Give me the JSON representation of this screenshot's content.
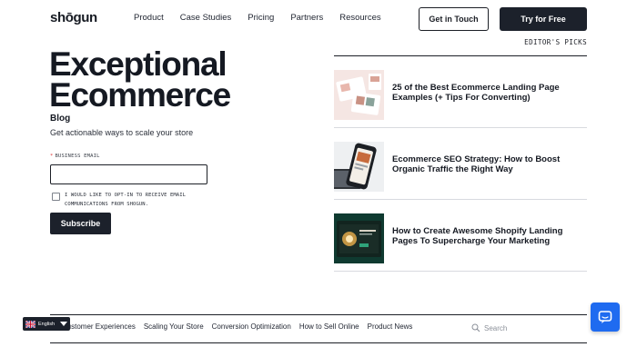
{
  "header": {
    "logo": "shōgun",
    "nav": [
      "Product",
      "Case Studies",
      "Pricing",
      "Partners",
      "Resources"
    ],
    "get_in_touch": "Get in Touch",
    "try_free": "Try for Free"
  },
  "hero": {
    "title_line1": "Exceptional",
    "title_line2": "Ecommerce",
    "subtitle": "Blog",
    "description": "Get actionable ways to scale your store"
  },
  "signup": {
    "required_mark": "*",
    "email_label": "BUSINESS EMAIL",
    "email_value": "",
    "optin_text": "I WOULD LIKE TO OPT-IN TO RECEIVE EMAIL COMMUNICATIONS FROM SHOGUN.",
    "optin_checked": false,
    "subscribe": "Subscribe"
  },
  "editors_picks": {
    "label": "EDITOR'S PICKS",
    "items": [
      {
        "title": "25 of the Best Ecommerce Landing Page Examples (+ Tips For Converting)"
      },
      {
        "title": "Ecommerce SEO Strategy: How to Boost Organic Traffic the Right Way"
      },
      {
        "title": "How to Create Awesome Shopify Landing Pages To Supercharge Your Marketing"
      }
    ]
  },
  "categories": {
    "items": [
      "ing Customer Experiences",
      "Scaling Your Store",
      "Conversion Optimization",
      "How to Sell Online",
      "Product News"
    ],
    "search_placeholder": "Search"
  },
  "language": {
    "label": "English"
  },
  "colors": {
    "dark": "#1c212b",
    "chat": "#1f6bf0"
  }
}
